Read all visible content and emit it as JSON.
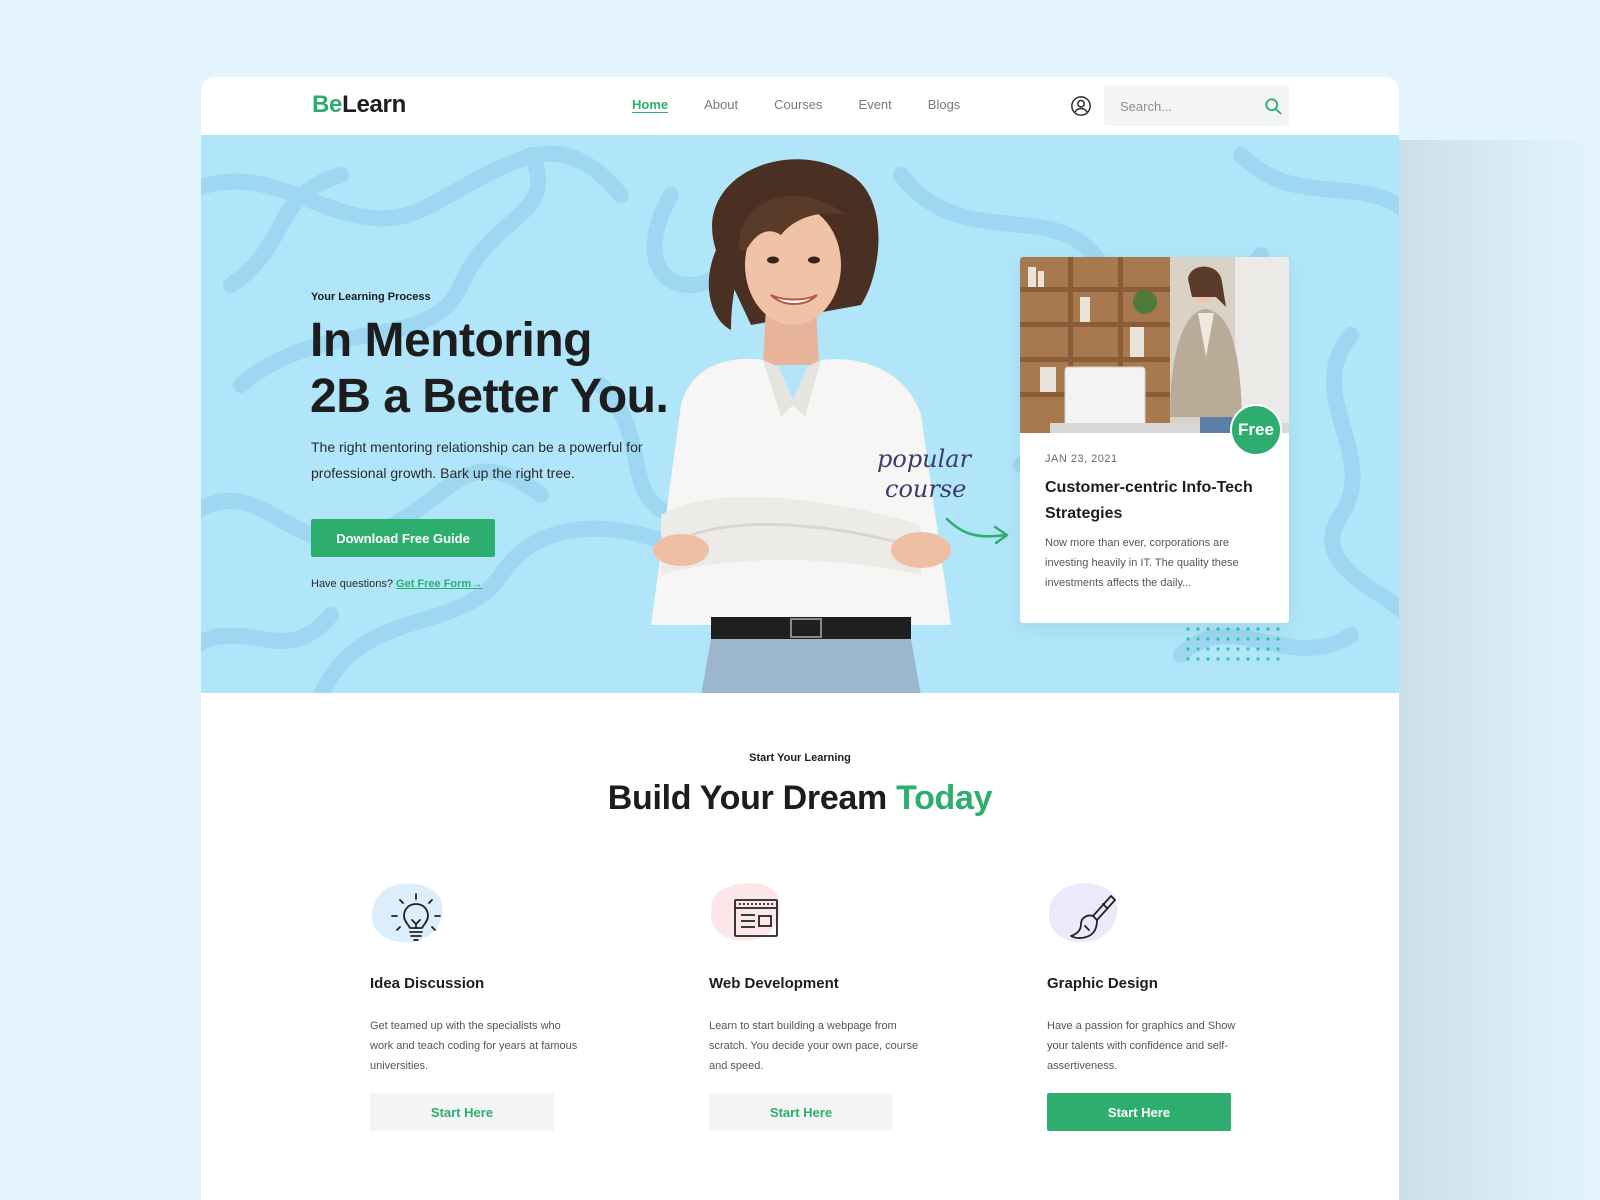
{
  "brand": {
    "logo_part1": "Be",
    "logo_part2": "Learn"
  },
  "nav": {
    "links": [
      "Home",
      "About",
      "Courses",
      "Event",
      "Blogs"
    ],
    "active": "Home"
  },
  "search": {
    "placeholder": "Search..."
  },
  "icons": {
    "user": "user-circle-icon",
    "search": "search-icon",
    "arrow": "curved-arrow-icon",
    "idea": "lightbulb-icon",
    "web": "browser-window-icon",
    "design": "paint-brush-icon"
  },
  "colors": {
    "accent": "#2dae6f",
    "hero_bg": "#b1e5f9",
    "page_bg": "#e3f4fc",
    "text": "#1d1d1f"
  },
  "hero": {
    "eyebrow": "Your Learning Process",
    "headline_line1": "In Mentoring",
    "headline_line2": "2B a Better You.",
    "description": "The right mentoring relationship can be a powerful for professional growth. Bark up the right tree.",
    "cta_label": "Download Free Guide",
    "questions_text": "Have questions?",
    "questions_link": "Get Free Form",
    "questions_arrow": "→",
    "popular_line1": "popular",
    "popular_line2": "course"
  },
  "course_card": {
    "badge": "Free",
    "date": "JAN 23, 2021",
    "title": "Customer-centric Info-Tech Strategies",
    "description": "Now more than ever, corporations are investing heavily in IT. The quality these investments affects the daily..."
  },
  "section": {
    "eyebrow": "Start Your Learning",
    "title_part1": "Build Your Dream",
    "title_part2": "Today"
  },
  "features": [
    {
      "title": "Idea Discussion",
      "description": "Get teamed up with the specialists who work and teach coding for years at famous universities.",
      "button": "Start Here",
      "blob_color": "#dcedfb"
    },
    {
      "title": "Web Development",
      "description": "Learn to start building a webpage from scratch. You decide your own pace, course and speed.",
      "button": "Start Here",
      "blob_color": "#fde6ea"
    },
    {
      "title": "Graphic Design",
      "description": "Have a passion for graphics and Show your talents with confidence and self-assertiveness.",
      "button": "Start Here",
      "blob_color": "#ede8fb"
    }
  ]
}
